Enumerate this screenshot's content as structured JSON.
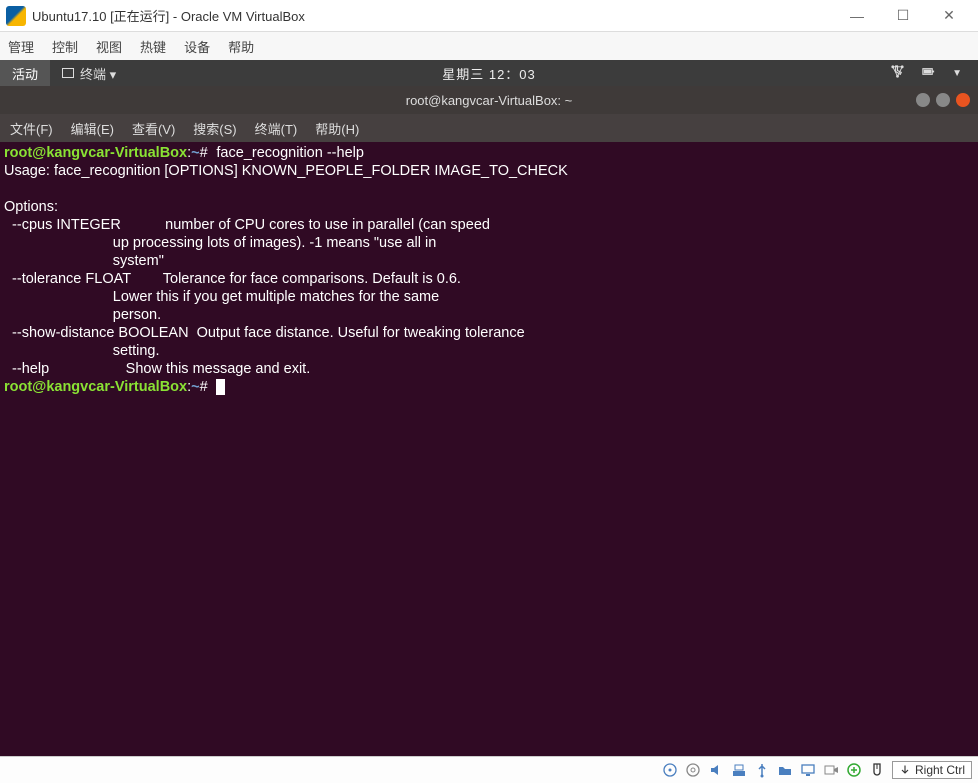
{
  "vb": {
    "title": "Ubuntu17.10 [正在运行] - Oracle VM VirtualBox",
    "menu": [
      "管理",
      "控制",
      "视图",
      "热键",
      "设备",
      "帮助"
    ],
    "hostkey": "Right Ctrl"
  },
  "ubuntu": {
    "activities": "活动",
    "term_label": "终端 ▾",
    "clock": "星期三 12：03"
  },
  "term": {
    "title": "root@kangvcar-VirtualBox: ~",
    "menu": [
      "文件(F)",
      "编辑(E)",
      "查看(V)",
      "搜索(S)",
      "终端(T)",
      "帮助(H)"
    ],
    "prompt_user": "root@kangvcar-VirtualBox",
    "prompt_colon": ":",
    "prompt_path": "~",
    "prompt_hash": "#",
    "cmd1": "face_recognition --help",
    "out": {
      "l1": "Usage: face_recognition [OPTIONS] KNOWN_PEOPLE_FOLDER IMAGE_TO_CHECK",
      "l3": "Options:",
      "l4": "  --cpus INTEGER           number of CPU cores to use in parallel (can speed",
      "l5": "                           up processing lots of images). -1 means \"use all in",
      "l6": "                           system\"",
      "l7": "  --tolerance FLOAT        Tolerance for face comparisons. Default is 0.6.",
      "l8": "                           Lower this if you get multiple matches for the same",
      "l9": "                           person.",
      "l10": "  --show-distance BOOLEAN  Output face distance. Useful for tweaking tolerance",
      "l11": "                           setting.",
      "l12": "  --help                   Show this message and exit."
    }
  }
}
